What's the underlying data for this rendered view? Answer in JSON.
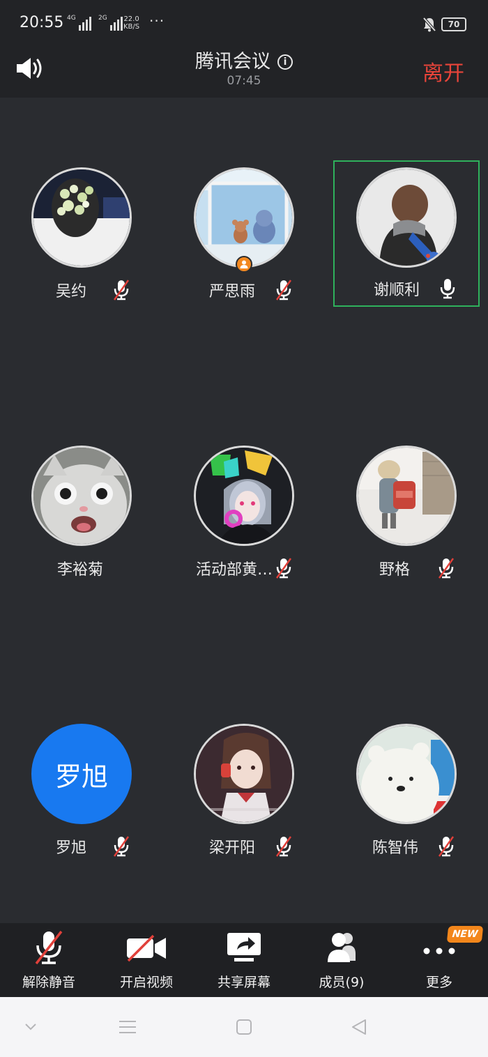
{
  "status_bar": {
    "time": "20:55",
    "signal1_label": "4G",
    "signal2_label": "2G",
    "net_speed_value": "22.0",
    "net_speed_unit": "KB/S",
    "dots": "···",
    "battery": "70"
  },
  "header": {
    "title": "腾讯会议",
    "elapsed": "07:45",
    "leave_label": "离开",
    "speaker_icon": "speaker-icon",
    "info_icon": "info-icon"
  },
  "participants": [
    {
      "name": "吴约",
      "mic": "muted"
    },
    {
      "name": "严思雨",
      "mic": "muted",
      "host": true
    },
    {
      "name": "谢顺利",
      "mic": "on",
      "active": true
    },
    {
      "name": "李裕菊",
      "mic": "none"
    },
    {
      "name": "活动部黄…",
      "mic": "muted"
    },
    {
      "name": "野格",
      "mic": "muted"
    },
    {
      "name": "罗旭",
      "mic": "muted",
      "avatar_text": "罗旭"
    },
    {
      "name": "梁开阳",
      "mic": "muted"
    },
    {
      "name": "陈智伟",
      "mic": "muted"
    }
  ],
  "toolbar": {
    "unmute_label": "解除静音",
    "video_label": "开启视频",
    "share_label": "共享屏幕",
    "members_label": "成员(9)",
    "more_label": "更多",
    "new_badge": "NEW"
  },
  "colors": {
    "accent_blue": "#1879f0",
    "leave_red": "#e8443a",
    "active_green": "#2fb15c",
    "host_orange": "#f3881f",
    "muted_red": "#e0403a"
  }
}
